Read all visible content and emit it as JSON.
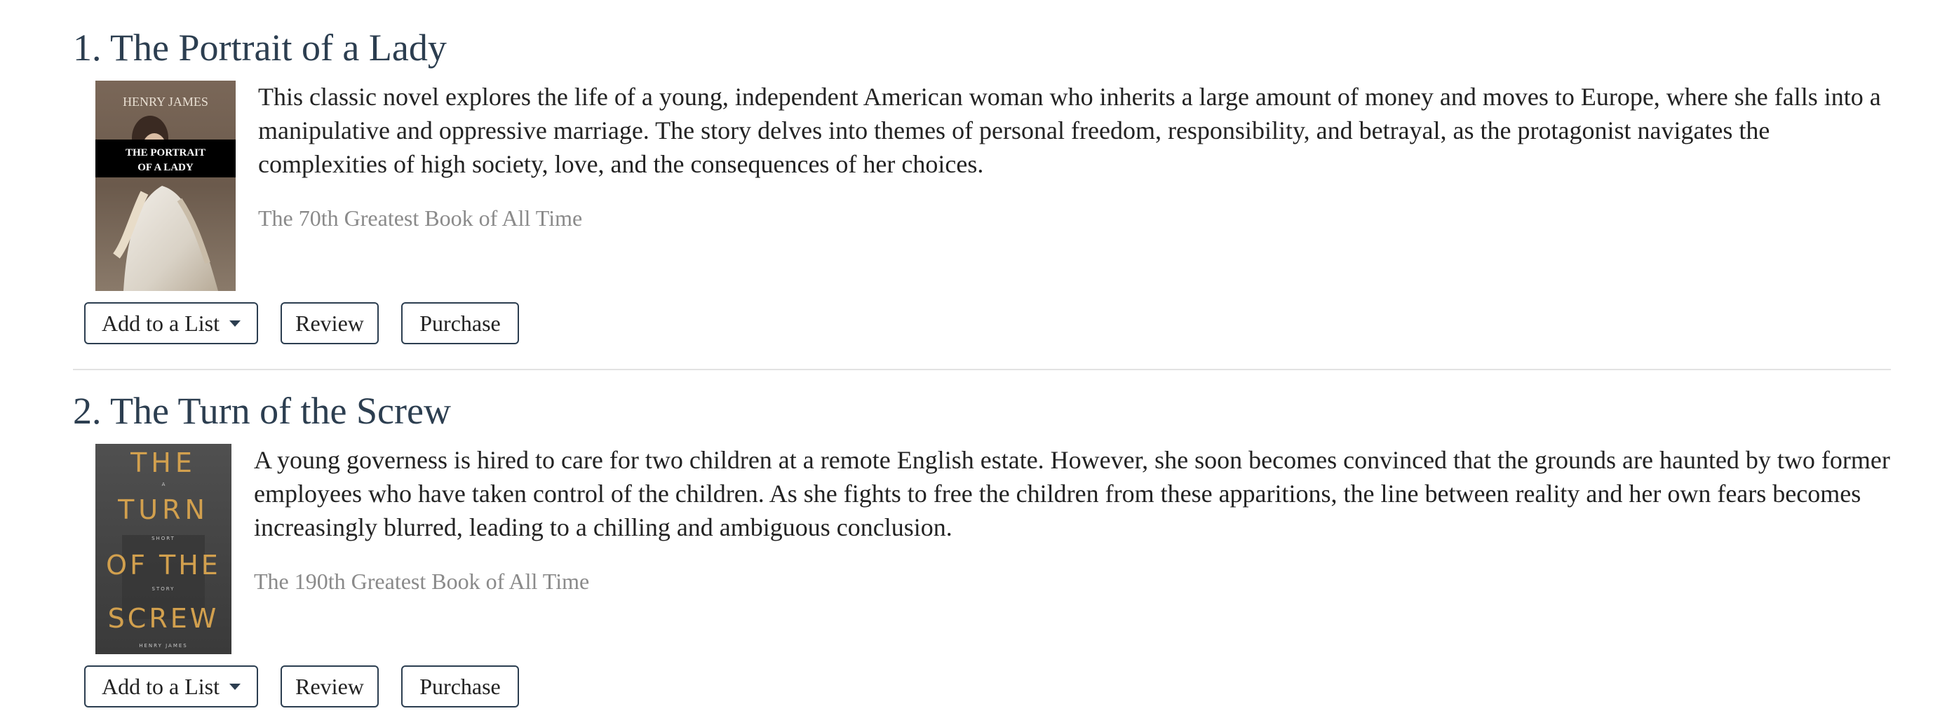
{
  "books": [
    {
      "title": "1. The Portrait of a Lady",
      "cover": {
        "author_text": "HENRY JAMES",
        "title_text_line1": "THE PORTRAIT",
        "title_text_line2": "OF A LADY"
      },
      "description": "This classic novel explores the life of a young, independent American woman who inherits a large amount of money and moves to Europe, where she falls into a manipulative and oppressive marriage. The story delves into themes of personal freedom, responsibility, and betrayal, as the protagonist navigates the complexities of high society, love, and the consequences of her choices.",
      "rank_text": "The 70th Greatest Book of All Time",
      "actions": {
        "add_to_list": "Add to a List",
        "review": "Review",
        "purchase": "Purchase"
      }
    },
    {
      "title": "2. The Turn of the Screw",
      "cover": {
        "line1": "THE",
        "line2": "TURN",
        "line3": "OF THE",
        "line4": "SCREW",
        "small_a": "A",
        "small_short": "SHORT",
        "small_story": "STORY",
        "author_text": "HENRY JAMES"
      },
      "description": "A young governess is hired to care for two children at a remote English estate. However, she soon becomes convinced that the grounds are haunted by two former employees who have taken control of the children. As she fights to free the children from these apparitions, the line between reality and her own fears becomes increasingly blurred, leading to a chilling and ambiguous conclusion.",
      "rank_text": "The 190th Greatest Book of All Time",
      "actions": {
        "add_to_list": "Add to a List",
        "review": "Review",
        "purchase": "Purchase"
      }
    }
  ],
  "icons": {
    "dropdown": "caret-down-icon"
  },
  "colors": {
    "title": "#2c3e50",
    "rank": "#8a8a8a",
    "button_border": "#2c3e50",
    "divider": "#e2e2e2"
  }
}
